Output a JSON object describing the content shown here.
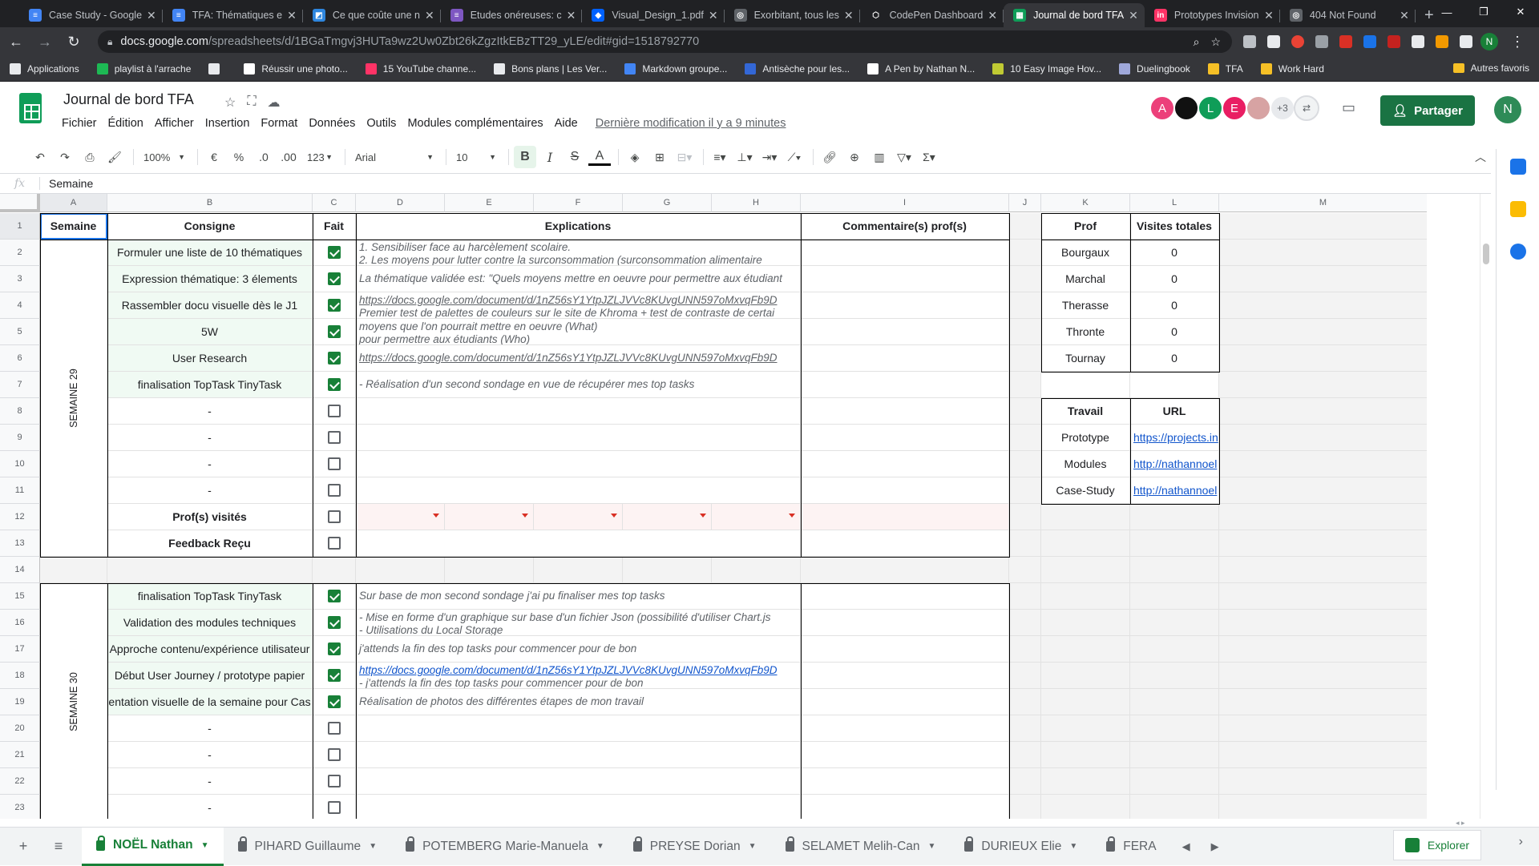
{
  "browser": {
    "tabs": [
      {
        "title": "Case Study - Google",
        "color": "#4285f4",
        "glyph": "≡"
      },
      {
        "title": "TFA: Thématiques e",
        "color": "#4285f4",
        "glyph": "≡"
      },
      {
        "title": "Ce que coûte une n",
        "color": "#2e86de",
        "glyph": "◩"
      },
      {
        "title": "Etudes onéreuses: c",
        "color": "#7e57c2",
        "glyph": "≡"
      },
      {
        "title": "Visual_Design_1.pdf",
        "color": "#0061ff",
        "glyph": "◆"
      },
      {
        "title": "Exorbitant, tous les",
        "color": "#5f6368",
        "glyph": "◎"
      },
      {
        "title": "CodePen Dashboard",
        "color": "#202124",
        "glyph": "⬡"
      },
      {
        "title": "Journal de bord TFA",
        "color": "#0f9d58",
        "glyph": "▦",
        "active": true
      },
      {
        "title": "Prototypes Invision",
        "color": "#ff3366",
        "glyph": "in"
      },
      {
        "title": "404 Not Found",
        "color": "#5f6368",
        "glyph": "◎"
      }
    ],
    "url_host": "docs.google.com",
    "url_path": "/spreadsheets/d/1BGaTmgvj3HUTa9wz2Uw0Zbt26kZgzItkEBzTT29_yLE/edit#gid=1518792770",
    "profile_initial": "N",
    "bookmarks": [
      {
        "label": "Applications",
        "color": "#e8eaed"
      },
      {
        "label": "playlist à l'arrache",
        "color": "#1db954"
      },
      {
        "label": "",
        "color": "#e8eaed"
      },
      {
        "label": "Réussir une photo...",
        "color": "#ffffff"
      },
      {
        "label": "15 YouTube channe...",
        "color": "#ff3366"
      },
      {
        "label": "Bons plans | Les Ver...",
        "color": "#e8eaed"
      },
      {
        "label": "Markdown groupe...",
        "color": "#4285f4"
      },
      {
        "label": "Antisèche pour les...",
        "color": "#3367d6"
      },
      {
        "label": "A Pen by Nathan N...",
        "color": "#ffffff"
      },
      {
        "label": "10 Easy Image Hov...",
        "color": "#c0ca33"
      },
      {
        "label": "Duelingbook",
        "color": "#9fa8da"
      },
      {
        "label": "TFA",
        "color": "#f6c026"
      },
      {
        "label": "Work Hard",
        "color": "#f6c026"
      }
    ],
    "bookmark_other": "Autres favoris"
  },
  "app": {
    "title": "Journal de bord TFA",
    "menu": [
      "Fichier",
      "Édition",
      "Afficher",
      "Insertion",
      "Format",
      "Données",
      "Outils",
      "Modules complémentaires",
      "Aide"
    ],
    "last_edit": "Dernière modification il y a 9 minutes",
    "share_label": "Partager",
    "account_initial": "N",
    "collaborators": [
      {
        "initial": "A",
        "color": "#ec407a"
      },
      {
        "initial": "",
        "color": "#111111"
      },
      {
        "initial": "L",
        "color": "#0f9d58"
      },
      {
        "initial": "E",
        "color": "#e91e63"
      },
      {
        "initial": "",
        "color": "#d7a3a3"
      }
    ],
    "more_collaborators": "+3"
  },
  "toolbar": {
    "zoom": "100%",
    "currency": "€",
    "percent": "%",
    "dec_less": ".0",
    "dec_more": ".00",
    "num_format": "123",
    "font": "Arial",
    "font_size": "10"
  },
  "formula": {
    "fx": "fx",
    "value": "Semaine"
  },
  "columns": [
    "A",
    "B",
    "C",
    "D",
    "E",
    "F",
    "G",
    "H",
    "I",
    "J",
    "K",
    "L",
    "M"
  ],
  "rows": [
    "1",
    "2",
    "3",
    "4",
    "5",
    "6",
    "7",
    "8",
    "9",
    "10",
    "11",
    "12",
    "13",
    "14",
    "15",
    "16",
    "17",
    "18",
    "19",
    "20",
    "21",
    "22",
    "23"
  ],
  "headers": {
    "semaine": "Semaine",
    "consigne": "Consigne",
    "fait": "Fait",
    "explications": "Explications",
    "commentaires": "Commentaire(s) prof(s)",
    "prof": "Prof",
    "visites": "Visites totales",
    "travail": "Travail",
    "url": "URL"
  },
  "week29": {
    "label": "SEMAINE 29",
    "tasks": [
      {
        "consigne": "Formuler une liste de 10 thématiques",
        "done": true,
        "expl": [
          "1.  Sensibiliser face au harcèlement scolaire.",
          "2.  Les moyens pour lutter contre la surconsommation  (surconsommation alimentaire"
        ],
        "style": "two"
      },
      {
        "consigne": "Expression thématique: 3 élements",
        "done": true,
        "expl": [
          "La thématique validée est: \"Quels moyens mettre en oeuvre pour permettre aux étudiant"
        ],
        "style": "one"
      },
      {
        "consigne": "Rassembler docu visuelle dès le J1",
        "done": true,
        "expl": [
          "https://docs.google.com/document/d/1nZ56sY1YtpJZLJVVc8KUvgUNN597oMxvqFb9D",
          "Premier test de palettes de couleurs sur le site de Khroma + test de contraste de certai"
        ],
        "style": "two"
      },
      {
        "consigne": "5W",
        "done": true,
        "expl": [
          "moyens que l'on pourrait mettre en oeuvre (What)",
          "pour permettre aux étudiants (Who)"
        ],
        "style": "two"
      },
      {
        "consigne": "User Research",
        "done": true,
        "expl": [
          "https://docs.google.com/document/d/1nZ56sY1YtpJZLJVVc8KUvgUNN597oMxvqFb9D"
        ],
        "style": "link"
      },
      {
        "consigne": "finalisation TopTask TinyTask",
        "done": true,
        "expl": [
          "- Réalisation d'un second sondage en vue de récupérer mes top tasks"
        ],
        "style": "one"
      },
      {
        "consigne": "-",
        "done": false,
        "expl": [],
        "style": "one"
      },
      {
        "consigne": "-",
        "done": false,
        "expl": [],
        "style": "one"
      },
      {
        "consigne": "-",
        "done": false,
        "expl": [],
        "style": "one"
      },
      {
        "consigne": "-",
        "done": false,
        "expl": [],
        "style": "one"
      }
    ],
    "prof_visites_label": "Prof(s) visités",
    "feedback_label": "Feedback Reçu"
  },
  "week30": {
    "label": "SEMAINE 30",
    "tasks": [
      {
        "consigne": "finalisation TopTask TinyTask",
        "done": true,
        "expl": [
          "Sur base de mon second sondage j'ai pu finaliser mes top tasks"
        ],
        "style": "one"
      },
      {
        "consigne": "Validation des modules techniques",
        "done": true,
        "expl": [
          "- Mise en forme d'un graphique sur base d'un fichier Json (possibilité d'utiliser Chart.js",
          "- Utilisations du Local Storage"
        ],
        "style": "two"
      },
      {
        "consigne": "Approche contenu/expérience utilisateur",
        "done": true,
        "expl": [
          "j'attends la fin des top tasks pour commencer pour de bon"
        ],
        "style": "one"
      },
      {
        "consigne": "Début User Journey / prototype papier",
        "done": true,
        "expl": [
          "https://docs.google.com/document/d/1nZ56sY1YtpJZLJVVc8KUvgUNN597oMxvqFb9D",
          "- j'attends la fin des top tasks pour commencer pour de bon"
        ],
        "style": "twolink"
      },
      {
        "consigne": "entation visuelle de la semaine pour Cas",
        "done": true,
        "expl": [
          "Réalisation de photos des différentes étapes de mon travail"
        ],
        "style": "one"
      },
      {
        "consigne": "-",
        "done": false,
        "expl": [],
        "style": "one"
      },
      {
        "consigne": "-",
        "done": false,
        "expl": [],
        "style": "one"
      },
      {
        "consigne": "-",
        "done": false,
        "expl": [],
        "style": "one"
      },
      {
        "consigne": "-",
        "done": false,
        "expl": [],
        "style": "one"
      }
    ]
  },
  "profs": [
    {
      "name": "Bourgaux",
      "visits": "0"
    },
    {
      "name": "Marchal",
      "visits": "0"
    },
    {
      "name": "Therasse",
      "visits": "0"
    },
    {
      "name": "Thronte",
      "visits": "0"
    },
    {
      "name": "Tournay",
      "visits": "0"
    }
  ],
  "travaux": [
    {
      "name": "Prototype",
      "url": "https://projects.in"
    },
    {
      "name": "Modules",
      "url": "http://nathannoel"
    },
    {
      "name": "Case-Study",
      "url": "http://nathannoel"
    }
  ],
  "sheets": [
    {
      "name": "NOËL Nathan",
      "active": true
    },
    {
      "name": "PIHARD Guillaume"
    },
    {
      "name": "POTEMBERG Marie-Manuela"
    },
    {
      "name": "PREYSE Dorian"
    },
    {
      "name": "SELAMET Melih-Can"
    },
    {
      "name": "DURIEUX  Elie"
    },
    {
      "name": "FERA"
    }
  ],
  "explore_label": "Explorer"
}
